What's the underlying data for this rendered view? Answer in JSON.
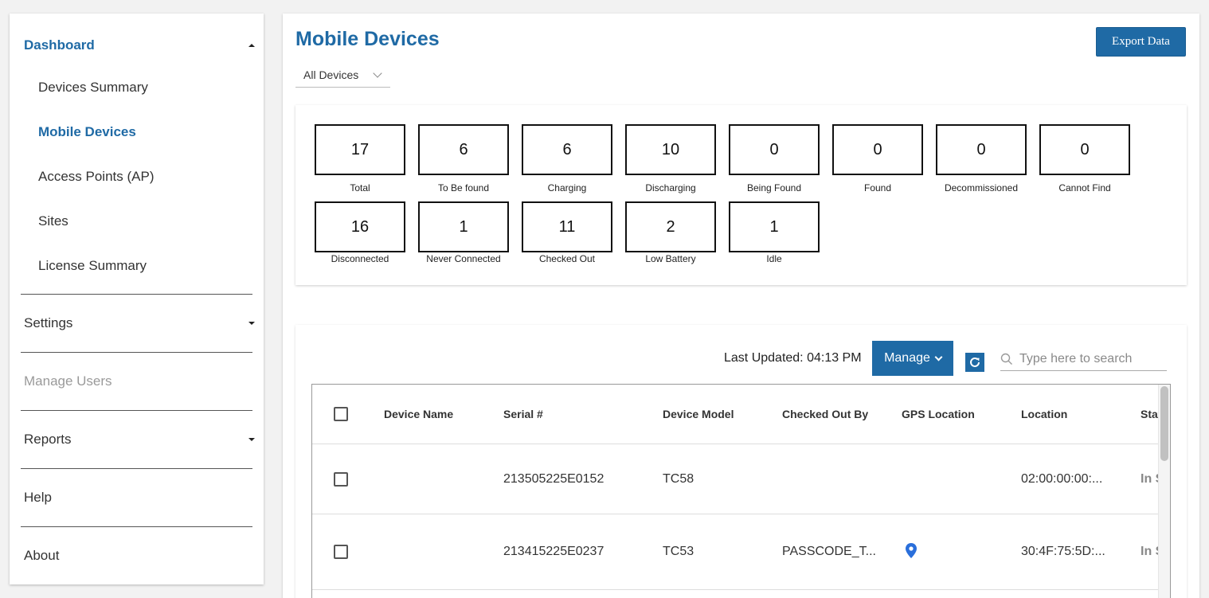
{
  "sidebar": {
    "dashboard_label": "Dashboard",
    "sub_items": [
      {
        "label": "Devices Summary"
      },
      {
        "label": "Mobile Devices"
      },
      {
        "label": "Access Points (AP)"
      },
      {
        "label": "Sites"
      },
      {
        "label": "License Summary"
      }
    ],
    "settings_label": "Settings",
    "manage_users_label": "Manage Users",
    "reports_label": "Reports",
    "help_label": "Help",
    "about_label": "About"
  },
  "header": {
    "title": "Mobile Devices",
    "export_label": "Export Data",
    "filter_value": "All Devices"
  },
  "stats": [
    {
      "value": "17",
      "label": "Total"
    },
    {
      "value": "6",
      "label": "To Be found"
    },
    {
      "value": "6",
      "label": "Charging"
    },
    {
      "value": "10",
      "label": "Discharging"
    },
    {
      "value": "0",
      "label": "Being Found"
    },
    {
      "value": "0",
      "label": "Found"
    },
    {
      "value": "0",
      "label": "Decommissioned"
    },
    {
      "value": "0",
      "label": "Cannot Find"
    },
    {
      "value": "16",
      "label": "Disconnected"
    },
    {
      "value": "1",
      "label": "Never Connected"
    },
    {
      "value": "11",
      "label": "Checked Out"
    },
    {
      "value": "2",
      "label": "Low Battery"
    },
    {
      "value": "1",
      "label": "Idle"
    }
  ],
  "toolbar": {
    "last_updated": "Last Updated: 04:13 PM",
    "manage_label": "Manage",
    "search_placeholder": "Type here to search"
  },
  "table": {
    "columns": [
      "Device Name",
      "Serial #",
      "Device Model",
      "Checked Out By",
      "GPS Location",
      "Location",
      "Stat"
    ],
    "rows": [
      {
        "device_name": "",
        "serial": "213505225E0152",
        "model": "TC58",
        "checked_out_by": "",
        "gps": false,
        "location": "02:00:00:00:...",
        "status": "In S"
      },
      {
        "device_name": "",
        "serial": "213415225E0237",
        "model": "TC53",
        "checked_out_by": "PASSCODE_T...",
        "gps": true,
        "location": "30:4F:75:5D:...",
        "status": "In S"
      }
    ]
  },
  "colors": {
    "accent": "#1f6aa5",
    "disabled_text": "#9a9a9a",
    "gps_pin": "#2a6fdb"
  },
  "icons": [
    "caret-up-icon",
    "caret-down-icon",
    "chevron-down-icon",
    "refresh-icon",
    "search-icon",
    "gps-pin-icon"
  ]
}
